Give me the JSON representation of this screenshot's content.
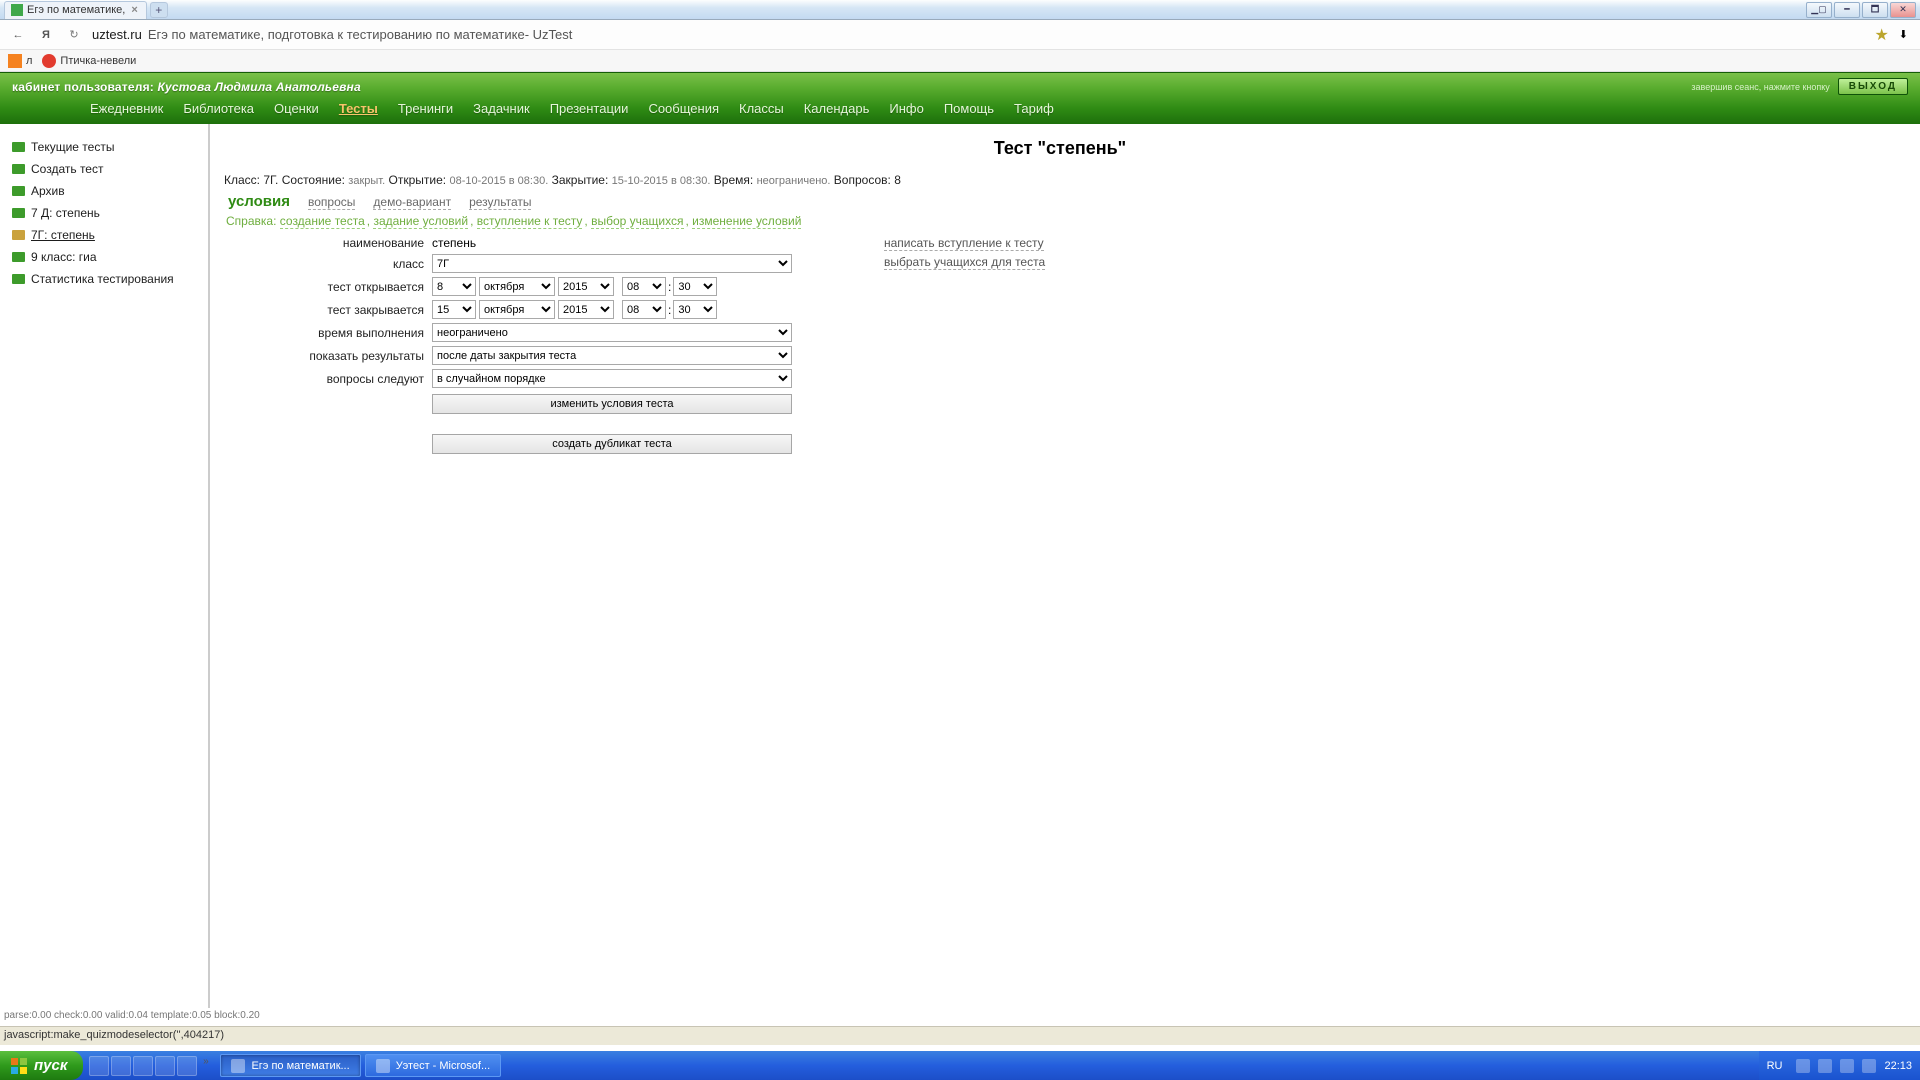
{
  "window": {
    "tab_title": "Егэ по математике,",
    "win_buttons": {
      "group": "▁▢",
      "min": "━",
      "max": "🗖",
      "close": "✕"
    }
  },
  "address": {
    "back": "←",
    "ya": "Я",
    "reload": "↻",
    "host": "uztest.ru",
    "page_title": "Егэ по математике, подготовка к тестированию по математике- UzTest",
    "star": "★",
    "download": "⬇"
  },
  "bookmarks": {
    "ok_label": "л",
    "opera_label": "Птичка-невели"
  },
  "greenheader": {
    "user_prefix": "кабинет пользователя:",
    "user_name": "Кустова Людмила Анатольевна",
    "hint": "завершив сеанс, нажмите кнопку",
    "exit": "ВЫХОД",
    "nav": [
      "Ежедневник",
      "Библиотека",
      "Оценки",
      "Тесты",
      "Тренинги",
      "Задачник",
      "Презентации",
      "Сообщения",
      "Классы",
      "Календарь",
      "Инфо",
      "Помощь",
      "Тариф"
    ],
    "nav_active_index": 3
  },
  "sidebar": {
    "items": [
      {
        "label": "Текущие тесты",
        "type": "page"
      },
      {
        "label": "Создать тест",
        "type": "page"
      },
      {
        "label": "Архив",
        "type": "page"
      },
      {
        "label": "7 Д: степень",
        "type": "page"
      },
      {
        "label": "7Г: степень",
        "type": "book",
        "active": true
      },
      {
        "label": "9 класс: гиа",
        "type": "page"
      },
      {
        "label": "Статистика тестирования",
        "type": "page"
      }
    ]
  },
  "content": {
    "title": "Тест \"степень\"",
    "info": {
      "class_l": "Класс:",
      "class_v": "7Г.",
      "state_l": "Состояние:",
      "state_v": "закрыт.",
      "open_l": "Открытие:",
      "open_v": "08-10-2015 в 08:30.",
      "close_l": "Закрытие:",
      "close_v": "15-10-2015 в 08:30.",
      "time_l": "Время:",
      "time_v": "неограничено.",
      "q_l": "Вопросов:",
      "q_v": "8"
    },
    "tabs": {
      "conditions": "условия",
      "questions": "вопросы",
      "demo": "демо-вариант",
      "results": "результаты"
    },
    "help_label": "Справка:",
    "help_links": [
      "создание теста",
      "задание условий",
      "вступление к тесту",
      "выбор учащихся",
      "изменение условий"
    ],
    "labels": {
      "name": "наименование",
      "class": "класс",
      "opens": "тест открывается",
      "closes": "тест закрывается",
      "duration": "время выполнения",
      "show_results": "показать результаты",
      "q_order": "вопросы следуют"
    },
    "values": {
      "name": "степень",
      "class": "7Г",
      "open_day": "8",
      "open_month": "октября",
      "open_year": "2015",
      "open_h": "08",
      "open_m": "30",
      "close_day": "15",
      "close_month": "октября",
      "close_year": "2015",
      "close_h": "08",
      "close_m": "30",
      "duration": "неограничено",
      "show_results": "после даты закрытия теста",
      "q_order": "в случайном порядке"
    },
    "buttons": {
      "change": "изменить условия теста",
      "duplicate": "создать дубликат теста"
    },
    "right_links": {
      "intro": "написать вступление к тесту",
      "pick": "выбрать учащихся для теста"
    }
  },
  "footer": {
    "debug": "parse:0.00   check:0.00   valid:0.04   template:0.05   block:0.20",
    "statusbar": "javascript:make_quizmodeselector('',404217)"
  },
  "taskbar": {
    "start": "пуск",
    "tasks": [
      {
        "label": "Егэ по математик...",
        "active": true
      },
      {
        "label": "Уэтест - Microsof...",
        "active": false
      }
    ],
    "lang": "RU",
    "clock": "22:13"
  }
}
